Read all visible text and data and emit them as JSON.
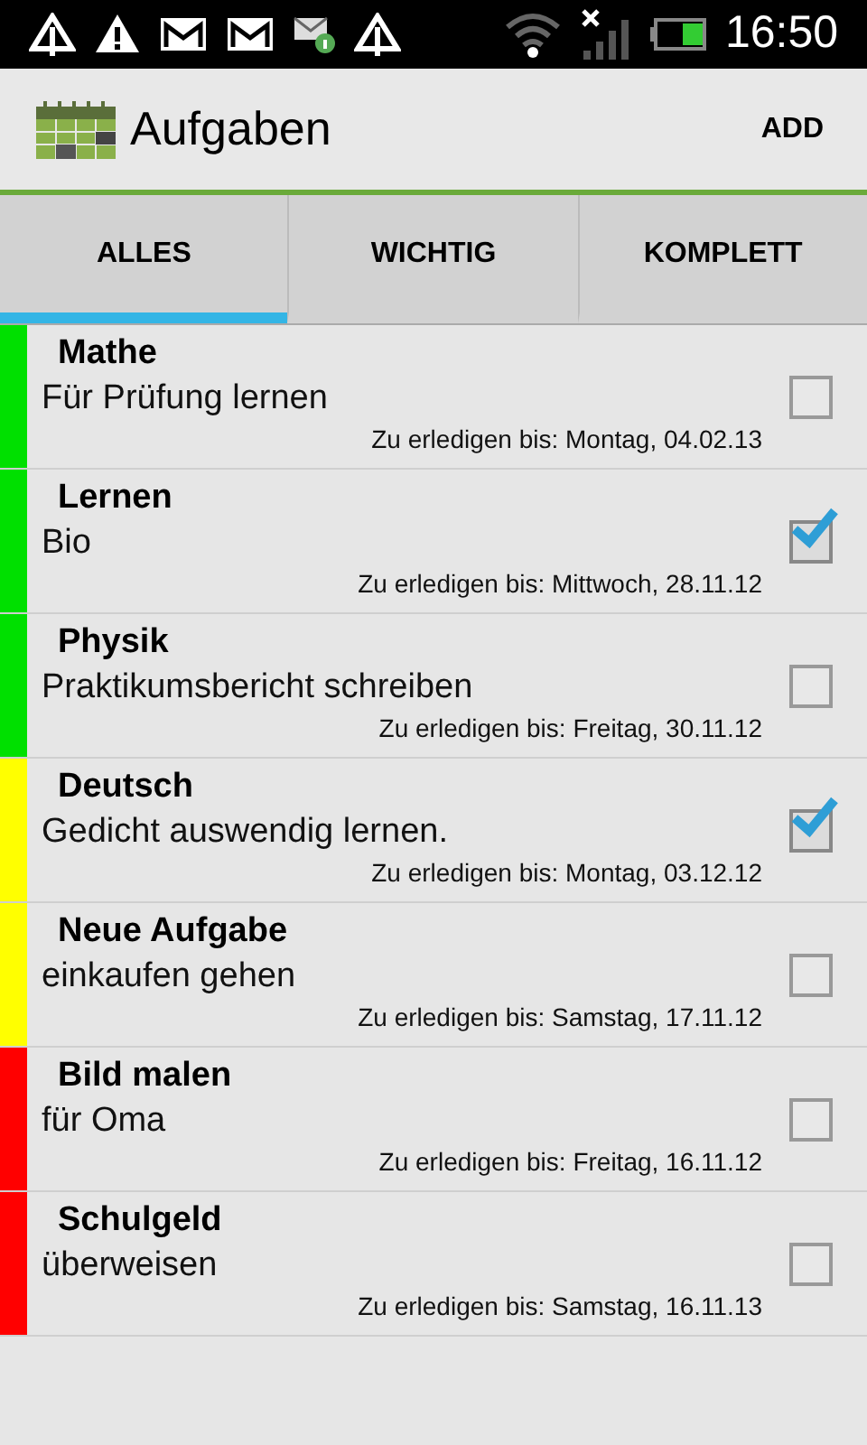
{
  "status_bar": {
    "time": "16:50"
  },
  "app_bar": {
    "title": "Aufgaben",
    "action": "ADD"
  },
  "tabs": [
    {
      "label": "ALLES",
      "selected": true
    },
    {
      "label": "WICHTIG",
      "selected": false
    },
    {
      "label": "KOMPLETT",
      "selected": false
    }
  ],
  "tasks": [
    {
      "title": "Mathe",
      "description": "Für Prüfung lernen",
      "due": "Zu erledigen bis: Montag, 04.02.13",
      "checked": false,
      "color": "#00e000"
    },
    {
      "title": "Lernen",
      "description": "Bio",
      "due": "Zu erledigen bis: Mittwoch, 28.11.12",
      "checked": true,
      "color": "#00e000"
    },
    {
      "title": "Physik",
      "description": "Praktikumsbericht schreiben",
      "due": "Zu erledigen bis: Freitag, 30.11.12",
      "checked": false,
      "color": "#00e000"
    },
    {
      "title": "Deutsch",
      "description": "Gedicht auswendig lernen.",
      "due": "Zu erledigen bis: Montag, 03.12.12",
      "checked": true,
      "color": "#ffff00"
    },
    {
      "title": "Neue Aufgabe",
      "description": "einkaufen gehen",
      "due": "Zu erledigen bis: Samstag, 17.11.12",
      "checked": false,
      "color": "#ffff00"
    },
    {
      "title": "Bild malen",
      "description": "für Oma",
      "due": "Zu erledigen bis: Freitag, 16.11.12",
      "checked": false,
      "color": "#ff0000"
    },
    {
      "title": "Schulgeld",
      "description": "überweisen",
      "due": "Zu erledigen bis: Samstag, 16.11.13",
      "checked": false,
      "color": "#ff0000"
    }
  ]
}
